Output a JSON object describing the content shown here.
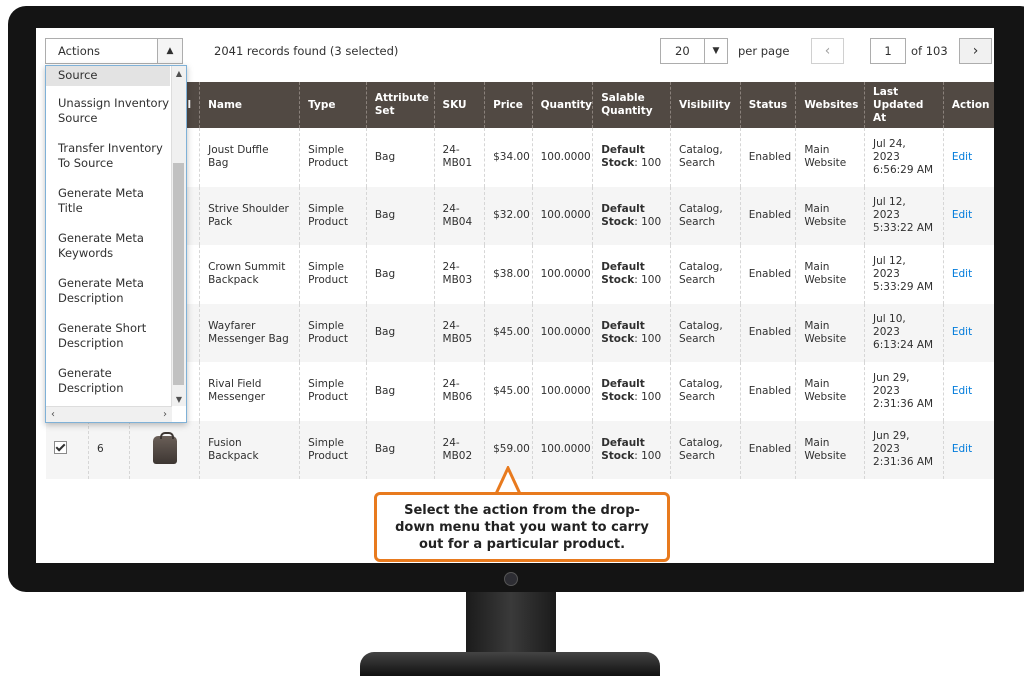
{
  "toolbar": {
    "actions_label": "Actions",
    "records_text": "2041 records found (3 selected)",
    "per_page_value": "20",
    "per_page_label": "per page",
    "page_input": "1",
    "of_pages": "of 103"
  },
  "actions_menu": {
    "items": [
      "Source",
      "Unassign Inventory Source",
      "Transfer Inventory To Source",
      "Generate Meta Title",
      "Generate Meta Keywords",
      "Generate Meta Description",
      "Generate Short Description",
      "Generate Description"
    ]
  },
  "table": {
    "headers": {
      "thumb": "il",
      "name": "Name",
      "type": "Type",
      "attr_set": "Attribute Set",
      "sku": "SKU",
      "price": "Price",
      "quantity": "Quantity",
      "salable": "Salable Quantity",
      "visibility": "Visibility",
      "status": "Status",
      "websites": "Websites",
      "updated": "Last Updated At",
      "action": "Action"
    },
    "rows": [
      {
        "id": "",
        "name": "Joust Duffle Bag",
        "type": "Simple Product",
        "attr_set": "Bag",
        "sku": "24-MB01",
        "price": "$34.00",
        "quantity": "100.0000",
        "sal_label": "Default Stock",
        "sal_value": ": 100",
        "visibility": "Catalog, Search",
        "status": "Enabled",
        "websites": "Main Website",
        "updated": "Jul 24, 2023 6:56:29 AM",
        "action": "Edit"
      },
      {
        "id": "",
        "name": "Strive Shoulder Pack",
        "type": "Simple Product",
        "attr_set": "Bag",
        "sku": "24-MB04",
        "price": "$32.00",
        "quantity": "100.0000",
        "sal_label": "Default Stock",
        "sal_value": ": 100",
        "visibility": "Catalog, Search",
        "status": "Enabled",
        "websites": "Main Website",
        "updated": "Jul 12, 2023 5:33:22 AM",
        "action": "Edit"
      },
      {
        "id": "",
        "name": "Crown Summit Backpack",
        "type": "Simple Product",
        "attr_set": "Bag",
        "sku": "24-MB03",
        "price": "$38.00",
        "quantity": "100.0000",
        "sal_label": "Default Stock",
        "sal_value": ": 100",
        "visibility": "Catalog, Search",
        "status": "Enabled",
        "websites": "Main Website",
        "updated": "Jul 12, 2023 5:33:29 AM",
        "action": "Edit"
      },
      {
        "id": "",
        "name": "Wayfarer Messenger Bag",
        "type": "Simple Product",
        "attr_set": "Bag",
        "sku": "24-MB05",
        "price": "$45.00",
        "quantity": "100.0000",
        "sal_label": "Default Stock",
        "sal_value": ": 100",
        "visibility": "Catalog, Search",
        "status": "Enabled",
        "websites": "Main Website",
        "updated": "Jul 10, 2023 6:13:24 AM",
        "action": "Edit"
      },
      {
        "id": "",
        "name": "Rival Field Messenger",
        "type": "Simple Product",
        "attr_set": "Bag",
        "sku": "24-MB06",
        "price": "$45.00",
        "quantity": "100.0000",
        "sal_label": "Default Stock",
        "sal_value": ": 100",
        "visibility": "Catalog, Search",
        "status": "Enabled",
        "websites": "Main Website",
        "updated": "Jun 29, 2023 2:31:36 AM",
        "action": "Edit"
      },
      {
        "id": "6",
        "name": "Fusion Backpack",
        "type": "Simple Product",
        "attr_set": "Bag",
        "sku": "24-MB02",
        "price": "$59.00",
        "quantity": "100.0000",
        "sal_label": "Default Stock",
        "sal_value": ": 100",
        "visibility": "Catalog, Search",
        "status": "Enabled",
        "websites": "Main Website",
        "updated": "Jun 29, 2023 2:31:36 AM",
        "action": "Edit"
      }
    ]
  },
  "callout": {
    "text": "Select the action from the drop-down menu that you want to carry out for a particular product.",
    "border_color": "#e87a1e"
  },
  "colors": {
    "header_bg": "#514943",
    "link": "#007bdb"
  }
}
